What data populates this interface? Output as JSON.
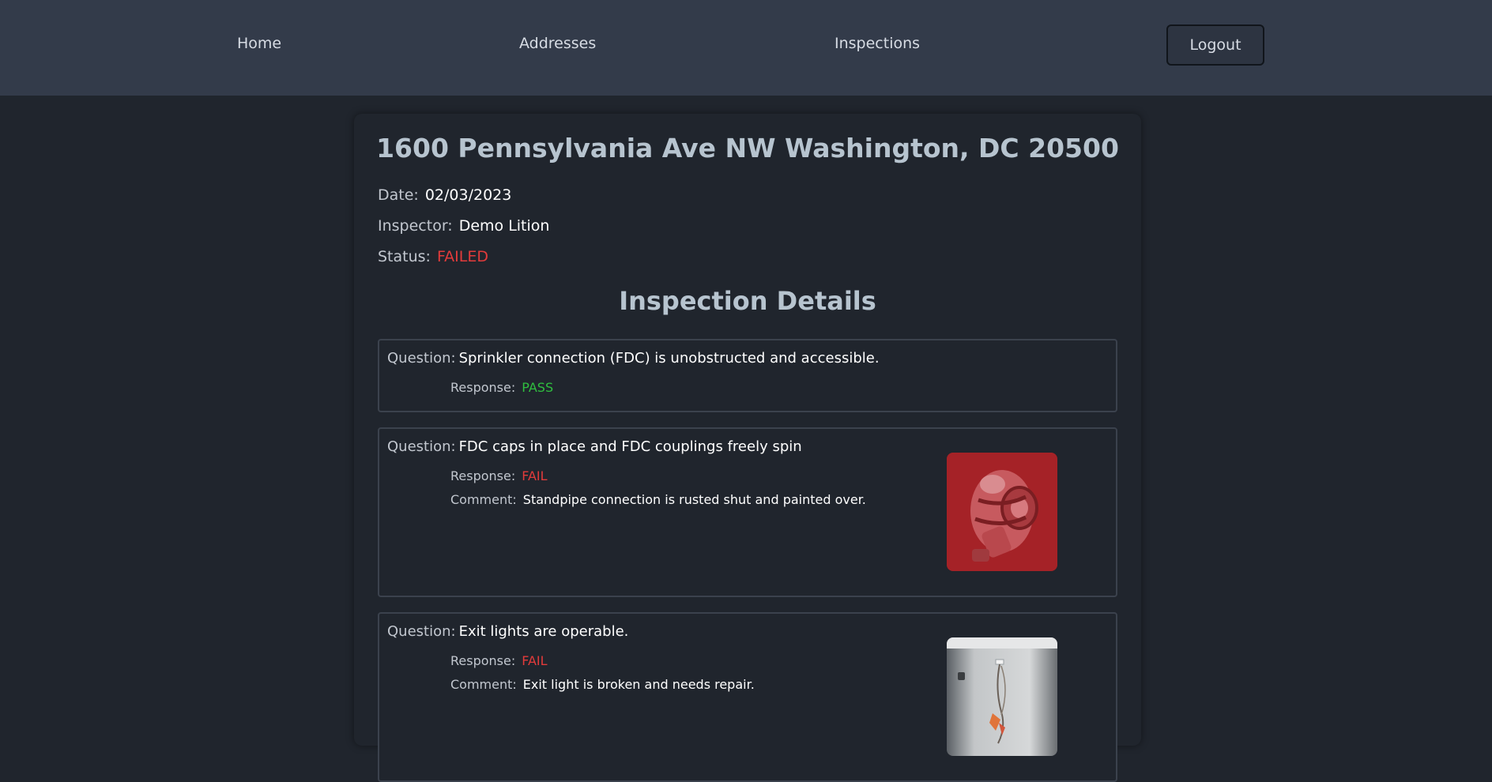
{
  "nav": {
    "home": "Home",
    "addresses": "Addresses",
    "inspections": "Inspections",
    "logout": "Logout"
  },
  "inspection": {
    "address": "1600 Pennsylvania Ave NW Washington, DC 20500",
    "date_label": "Date:",
    "date": "02/03/2023",
    "inspector_label": "Inspector:",
    "inspector": "Demo Lition",
    "status_label": "Status:",
    "status": "FAILED",
    "status_color": "#e23b3b"
  },
  "details": {
    "title": "Inspection Details",
    "question_label": "Question:",
    "response_label": "Response:",
    "comment_label": "Comment:",
    "items": [
      {
        "question": "Sprinkler connection (FDC) is unobstructed and accessible.",
        "response": "PASS"
      },
      {
        "question": "FDC caps in place and FDC couplings freely spin",
        "response": "FAIL",
        "comment": "Standpipe connection is rusted shut and painted over.",
        "photo_icon": "rusted-fdc-photo"
      },
      {
        "question": "Exit lights are operable.",
        "response": "FAIL",
        "comment": "Exit light is broken and needs repair.",
        "photo_icon": "broken-exit-light-photo"
      }
    ]
  },
  "colors": {
    "pass": "#2fbf3f",
    "fail": "#e23b3b",
    "navbar": "#333b4a",
    "background": "#20252d"
  }
}
